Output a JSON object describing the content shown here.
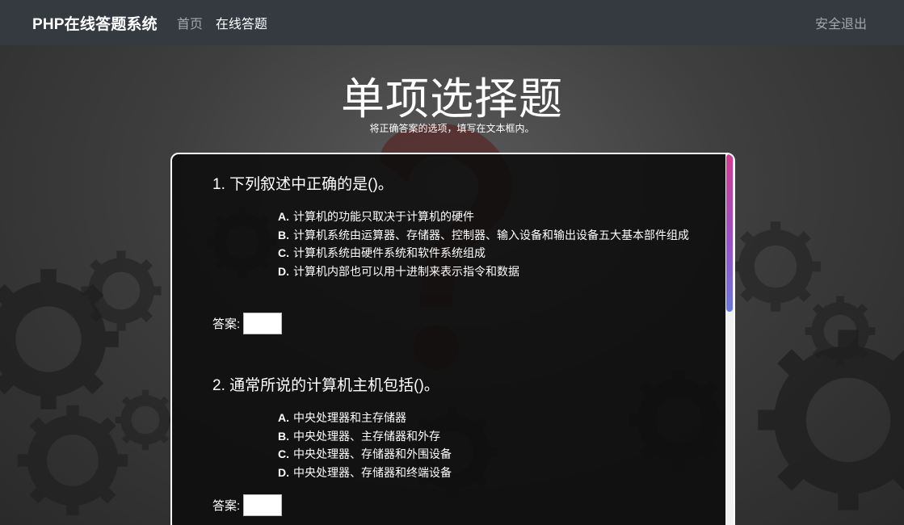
{
  "navbar": {
    "brand": "PHP在线答题系统",
    "links": [
      {
        "label": "首页"
      },
      {
        "label": "在线答题"
      }
    ],
    "logout_label": "安全退出"
  },
  "page": {
    "title": "单项选择题",
    "subtitle": "将正确答案的选项，填写在文本框内。"
  },
  "questions": [
    {
      "title": "1. 下列叙述中正确的是()。",
      "options": [
        {
          "key": "A.",
          "text": "计算机的功能只取决于计算机的硬件"
        },
        {
          "key": "B.",
          "text": "计算机系统由运算器、存储器、控制器、输入设备和输出设备五大基本部件组成"
        },
        {
          "key": "C.",
          "text": "计算机系统由硬件系统和软件系统组成"
        },
        {
          "key": "D.",
          "text": "计算机内部也可以用十进制来表示指令和数据"
        }
      ],
      "answer_label": "答案:",
      "answer_value": ""
    },
    {
      "title": "2. 通常所说的计算机主机包括()。",
      "options": [
        {
          "key": "A.",
          "text": "中央处理器和主存储器"
        },
        {
          "key": "B.",
          "text": "中央处理器、主存储器和外存"
        },
        {
          "key": "C.",
          "text": "中央处理器、存储器和外围设备"
        },
        {
          "key": "D.",
          "text": "中央处理器、存储器和终端设备"
        }
      ],
      "answer_label": "答案:",
      "answer_value": ""
    }
  ],
  "colors": {
    "navbar_bg": "#343a40",
    "scrollbar_gradient": [
      "#d63b8f",
      "#9a4fc9",
      "#6a78e0"
    ]
  }
}
